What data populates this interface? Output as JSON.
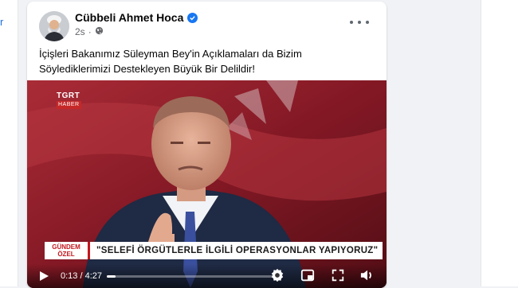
{
  "left_fragment": "r",
  "post": {
    "author": "Cübbeli Ahmet Hoca",
    "time_ago": "2s",
    "text": "İçişleri Bakanımız Süleyman Bey'in Açıklamaları da Bizim Söylediklerimizi Destekleyen Büyük Bir Delildir!",
    "verified": true
  },
  "video": {
    "channel_logo": "TGRT",
    "channel_sub": "HABER",
    "lower_third_label_line1": "GÜNDEM",
    "lower_third_label_line2": "ÖZEL",
    "lower_third_quote": "\"SELEFİ ÖRGÜTLERLE İLGİLİ OPERASYONLAR YAPIYORUZ\"",
    "time_display": "0:13 / 4:27",
    "progress": 0.049
  },
  "colors": {
    "verified_blue": "#1877f2",
    "lower_third_red": "#c4161c"
  }
}
